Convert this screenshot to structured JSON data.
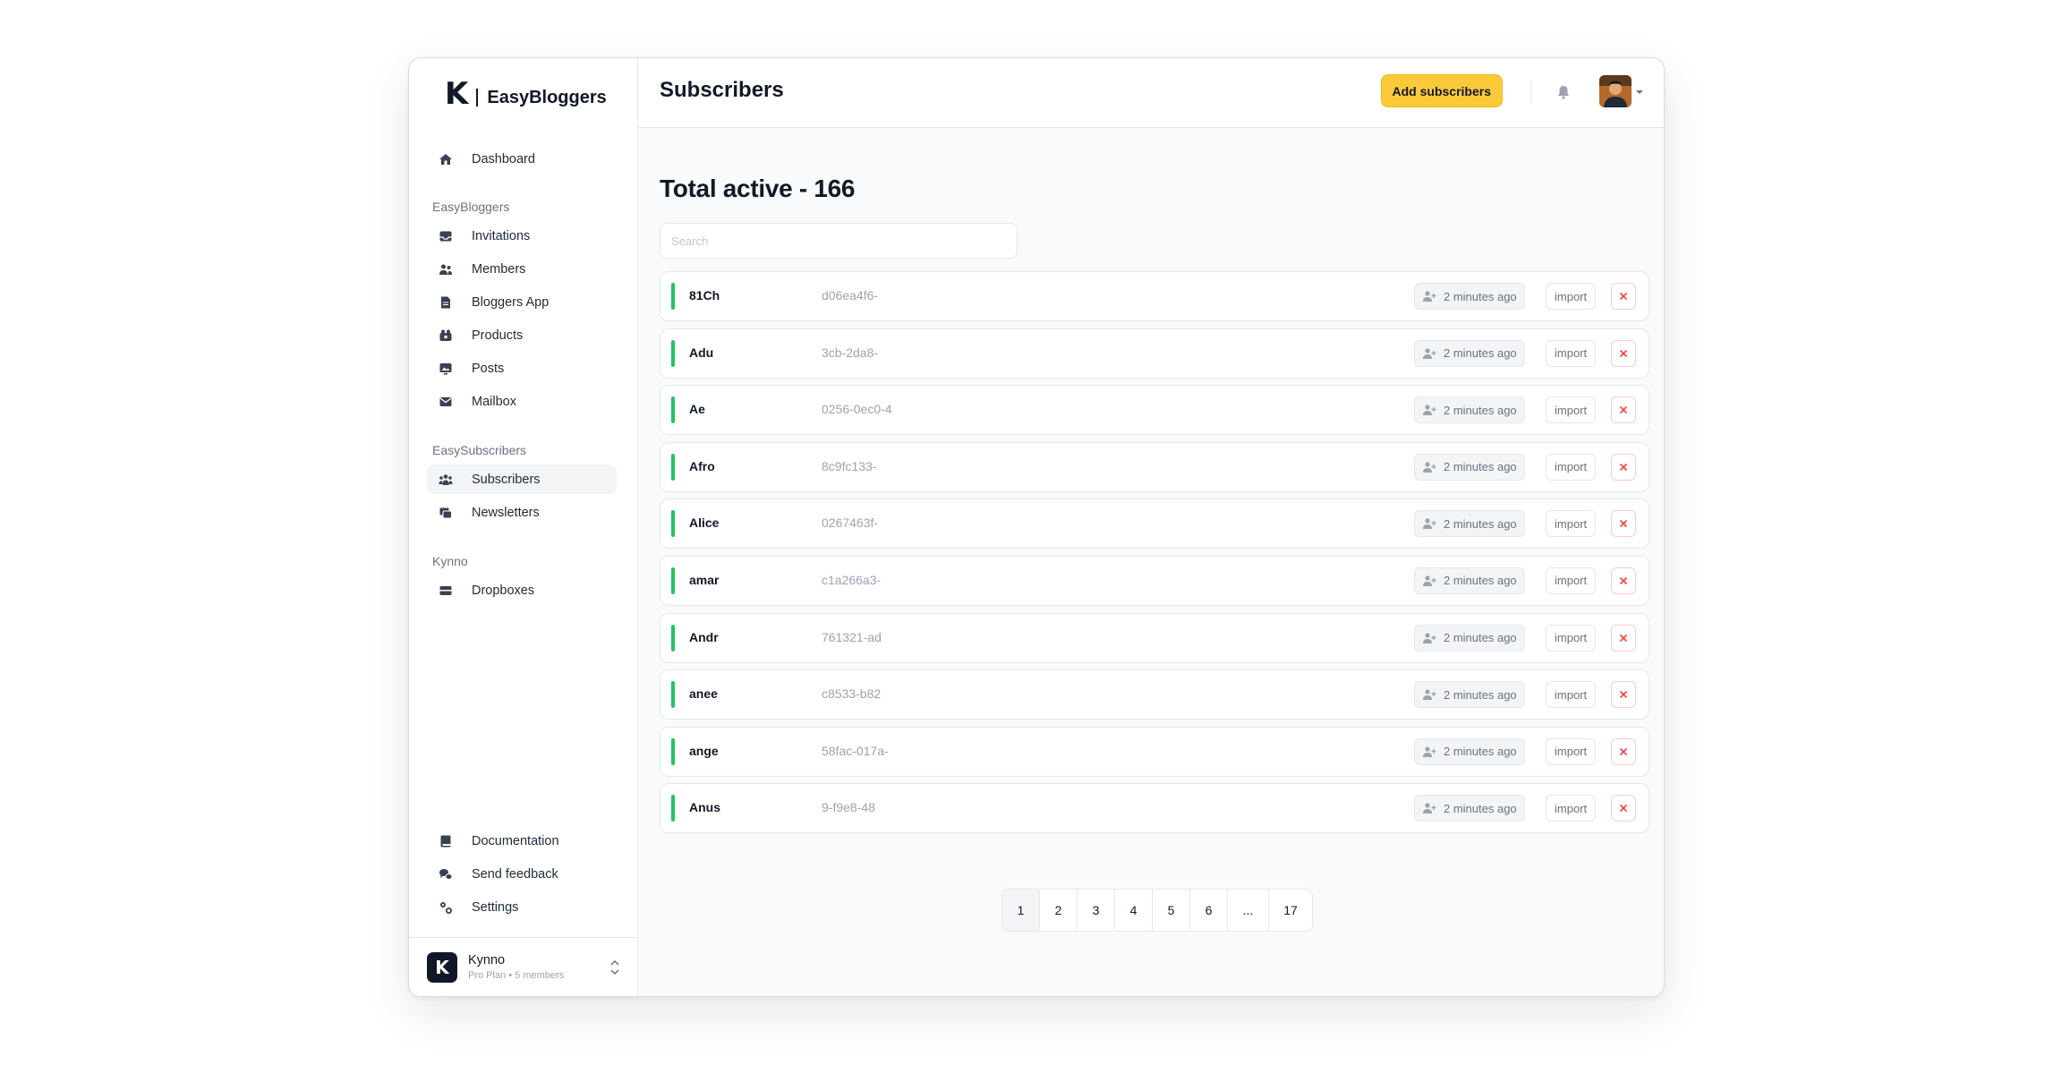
{
  "brand": {
    "logo_letter": "K",
    "name": "EasyBloggers"
  },
  "sidebar": {
    "top_items": [
      {
        "label": "Dashboard",
        "icon": "home-icon"
      }
    ],
    "sections": [
      {
        "title": "EasyBloggers",
        "items": [
          {
            "label": "Invitations",
            "icon": "inbox-icon"
          },
          {
            "label": "Members",
            "icon": "users-icon"
          },
          {
            "label": "Bloggers App",
            "icon": "document-icon"
          },
          {
            "label": "Products",
            "icon": "products-icon"
          },
          {
            "label": "Posts",
            "icon": "posts-icon"
          },
          {
            "label": "Mailbox",
            "icon": "mail-icon"
          }
        ]
      },
      {
        "title": "EasySubscribers",
        "items": [
          {
            "label": "Subscribers",
            "icon": "subscribers-icon",
            "active": true
          },
          {
            "label": "Newsletters",
            "icon": "newsletter-icon"
          }
        ]
      },
      {
        "title": "Kynno",
        "items": [
          {
            "label": "Dropboxes",
            "icon": "dropbox-icon"
          }
        ]
      }
    ],
    "bottom_items": [
      {
        "label": "Documentation",
        "icon": "book-icon"
      },
      {
        "label": "Send feedback",
        "icon": "chat-icon"
      },
      {
        "label": "Settings",
        "icon": "settings-icon"
      }
    ],
    "org": {
      "logo_letter": "K",
      "name": "Kynno",
      "plan": "Pro Plan • 5 members"
    }
  },
  "header": {
    "title": "Subscribers",
    "add_button": "Add subscribers",
    "accent_color": "#fbca3a"
  },
  "main": {
    "heading": "Total active - 166",
    "search_placeholder": "Search",
    "rows": [
      {
        "name": "81Ch",
        "id": "d06ea4f6-",
        "time": "2 minutes ago",
        "action": "import"
      },
      {
        "name": "Adu",
        "id": "3cb-2da8-",
        "time": "2 minutes ago",
        "action": "import"
      },
      {
        "name": "Ae",
        "id": "0256-0ec0-4",
        "time": "2 minutes ago",
        "action": "import"
      },
      {
        "name": "Afro",
        "id": "8c9fc133-",
        "time": "2 minutes ago",
        "action": "import"
      },
      {
        "name": "Alice",
        "id": "0267463f-",
        "time": "2 minutes ago",
        "action": "import"
      },
      {
        "name": "amar",
        "id": "c1a266a3-",
        "time": "2 minutes ago",
        "action": "import"
      },
      {
        "name": "Andr",
        "id": "761321-ad",
        "time": "2 minutes ago",
        "action": "import"
      },
      {
        "name": "anee",
        "id": "c8533-b82",
        "time": "2 minutes ago",
        "action": "import"
      },
      {
        "name": "ange",
        "id": "58fac-017a-",
        "time": "2 minutes ago",
        "action": "import"
      },
      {
        "name": "Anus",
        "id": "9-f9e8-48",
        "time": "2 minutes ago",
        "action": "import"
      }
    ],
    "status_color": "#22c55e",
    "pagination": [
      "1",
      "2",
      "3",
      "4",
      "5",
      "6",
      "...",
      "17"
    ],
    "current_page": "1"
  }
}
